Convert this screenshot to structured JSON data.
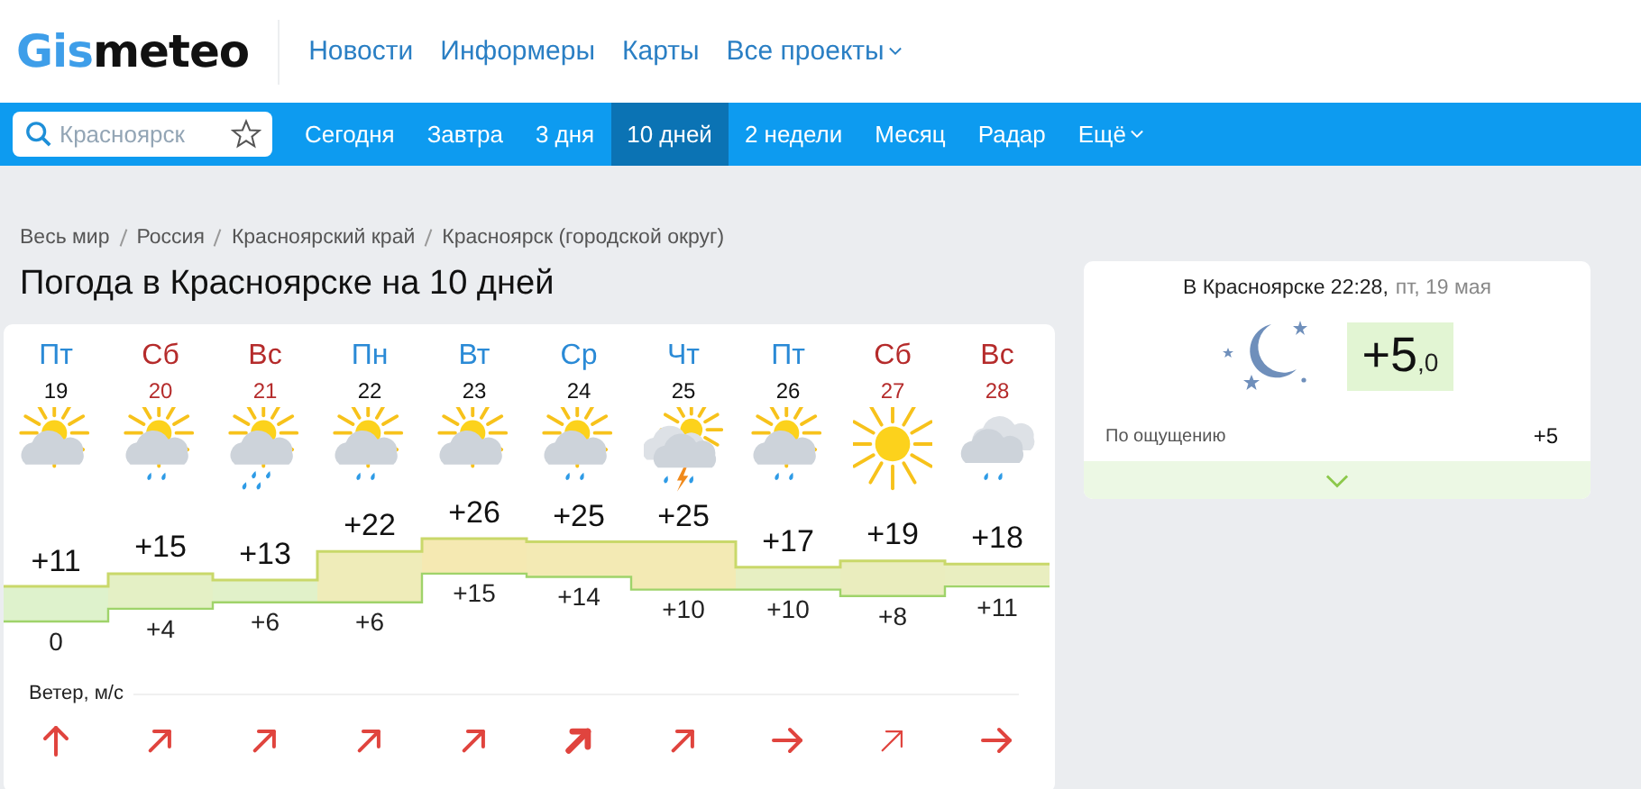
{
  "header": {
    "logo": {
      "accent": "Gis",
      "rest": "meteo"
    },
    "links": [
      {
        "label": "Новости",
        "dropdown": false
      },
      {
        "label": "Информеры",
        "dropdown": false
      },
      {
        "label": "Карты",
        "dropdown": false
      },
      {
        "label": "Все проекты",
        "dropdown": true
      }
    ]
  },
  "nav": {
    "search": {
      "placeholder": "Красноярск"
    },
    "tabs": [
      {
        "label": "Сегодня",
        "selected": false,
        "dropdown": false
      },
      {
        "label": "Завтра",
        "selected": false,
        "dropdown": false
      },
      {
        "label": "3 дня",
        "selected": false,
        "dropdown": false
      },
      {
        "label": "10 дней",
        "selected": true,
        "dropdown": false
      },
      {
        "label": "2 недели",
        "selected": false,
        "dropdown": false
      },
      {
        "label": "Месяц",
        "selected": false,
        "dropdown": false
      },
      {
        "label": "Радар",
        "selected": false,
        "dropdown": false
      },
      {
        "label": "Ещё",
        "selected": false,
        "dropdown": true
      }
    ]
  },
  "breadcrumbs": [
    "Весь мир",
    "Россия",
    "Красноярский край",
    "Красноярск (городской округ)"
  ],
  "title": "Погода в Красноярске на 10 дней",
  "forecast": {
    "days": [
      {
        "name": "Пт",
        "date": "19",
        "weekend": false,
        "weather": {
          "kind": "sun-cloud"
        },
        "max": "+11",
        "min": "0",
        "wind": {
          "kind": "n"
        }
      },
      {
        "name": "Сб",
        "date": "20",
        "weekend": true,
        "weather": {
          "kind": "sun-cloud-rain"
        },
        "max": "+15",
        "min": "+4",
        "wind": {
          "kind": "ne"
        }
      },
      {
        "name": "Вс",
        "date": "21",
        "weekend": true,
        "weather": {
          "kind": "sun-cloud-heavy-rain"
        },
        "max": "+13",
        "min": "+6",
        "wind": {
          "kind": "ne"
        }
      },
      {
        "name": "Пн",
        "date": "22",
        "weekend": false,
        "weather": {
          "kind": "sun-cloud-rain"
        },
        "max": "+22",
        "min": "+6",
        "wind": {
          "kind": "ne"
        }
      },
      {
        "name": "Вт",
        "date": "23",
        "weekend": false,
        "weather": {
          "kind": "sun-cloud"
        },
        "max": "+26",
        "min": "+15",
        "wind": {
          "kind": "ne"
        }
      },
      {
        "name": "Ср",
        "date": "24",
        "weekend": false,
        "weather": {
          "kind": "sun-cloud-rain"
        },
        "max": "+25",
        "min": "+14",
        "wind": {
          "kind": "ne-bold"
        }
      },
      {
        "name": "Чт",
        "date": "25",
        "weekend": false,
        "weather": {
          "kind": "cloud-storm"
        },
        "max": "+25",
        "min": "+10",
        "wind": {
          "kind": "ne"
        }
      },
      {
        "name": "Пт",
        "date": "26",
        "weekend": false,
        "weather": {
          "kind": "sun-cloud-rain"
        },
        "max": "+17",
        "min": "+10",
        "wind": {
          "kind": "e"
        }
      },
      {
        "name": "Сб",
        "date": "27",
        "weekend": true,
        "weather": {
          "kind": "sun"
        },
        "max": "+19",
        "min": "+8",
        "wind": {
          "kind": "ne-light"
        }
      },
      {
        "name": "Вс",
        "date": "28",
        "weekend": true,
        "weather": {
          "kind": "cloud-rain"
        },
        "max": "+18",
        "min": "+11",
        "wind": {
          "kind": "e"
        }
      }
    ],
    "wind_label": "Ветер, м/с"
  },
  "now": {
    "place_time": "В Красноярске 22:28,",
    "date": "пт, 19 мая",
    "temp": "+5",
    "temp_fraction": ",0",
    "feels_label": "По ощущению",
    "feels_value": "+5"
  }
}
